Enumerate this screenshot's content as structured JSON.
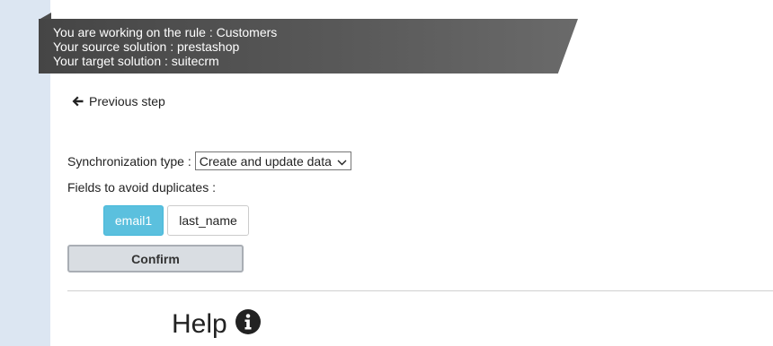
{
  "banner": {
    "line1": "You are working on the rule : Customers",
    "line2": "Your source solution : prestashop",
    "line3": "Your target solution : suitecrm"
  },
  "nav": {
    "previous_step": "Previous step",
    "previous_icon": "arrow-left-icon"
  },
  "sync": {
    "label": "Synchronization type :",
    "selected": "Create and update data"
  },
  "duplicates": {
    "label": "Fields to avoid duplicates :",
    "fields": [
      {
        "label": "email1",
        "selected": true
      },
      {
        "label": "last_name",
        "selected": false
      }
    ]
  },
  "confirm_label": "Confirm",
  "help": {
    "title": "Help",
    "icon": "info-circle-icon"
  },
  "colors": {
    "banner": "#4b4b4b",
    "chip_active": "#5bc0de",
    "left_rail": "#dce6f2"
  }
}
